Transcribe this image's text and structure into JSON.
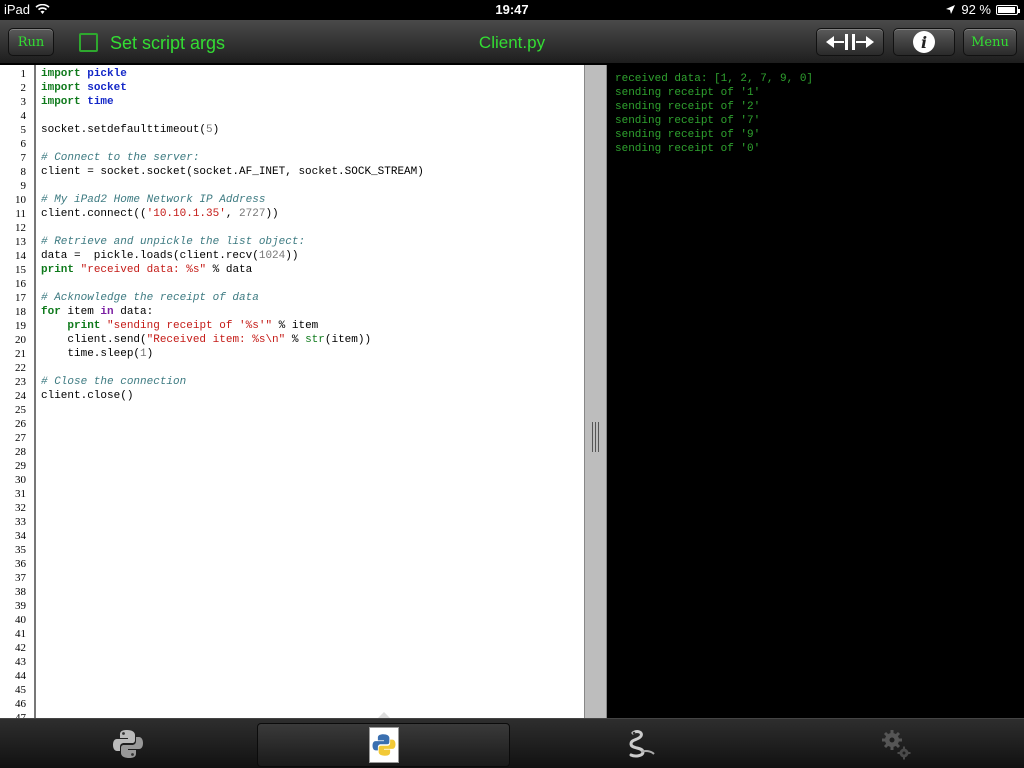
{
  "status_bar": {
    "device": "iPad",
    "time": "19:47",
    "battery": "92 %",
    "battery_level": 0.92
  },
  "toolbar": {
    "run_label": "Run",
    "script_args_label": "Set script args",
    "file_title": "Client.py",
    "menu_label": "Menu",
    "accent_color": "#33dd33"
  },
  "editor": {
    "line_count": 47,
    "lines": [
      "import pickle",
      "import socket",
      "import time",
      "",
      "socket.setdefaulttimeout(5)",
      "",
      "# Connect to the server:",
      "client = socket.socket(socket.AF_INET, socket.SOCK_STREAM)",
      "",
      "# My iPad2 Home Network IP Address",
      "client.connect(('10.10.1.35', 2727))",
      "",
      "# Retrieve and unpickle the list object:",
      "data =  pickle.loads(client.recv(1024))",
      "print \"received data: %s\" % data",
      "",
      "# Acknowledge the receipt of data",
      "for item in data:",
      "    print \"sending receipt of '%s'\" % item",
      "    client.send(\"Received item: %s\\n\" % str(item))",
      "    time.sleep(1)",
      "",
      "# Close the connection",
      "client.close()"
    ]
  },
  "console": {
    "lines": [
      "received data: [1, 2, 7, 9, 0]",
      "sending receipt of '1'",
      "sending receipt of '2'",
      "sending receipt of '7'",
      "sending receipt of '9'",
      "sending receipt of '0'"
    ]
  },
  "tabs": [
    {
      "icon": "python-logo-icon"
    },
    {
      "icon": "python-file-icon"
    },
    {
      "icon": "snake-icon"
    },
    {
      "icon": "gears-icon"
    }
  ]
}
